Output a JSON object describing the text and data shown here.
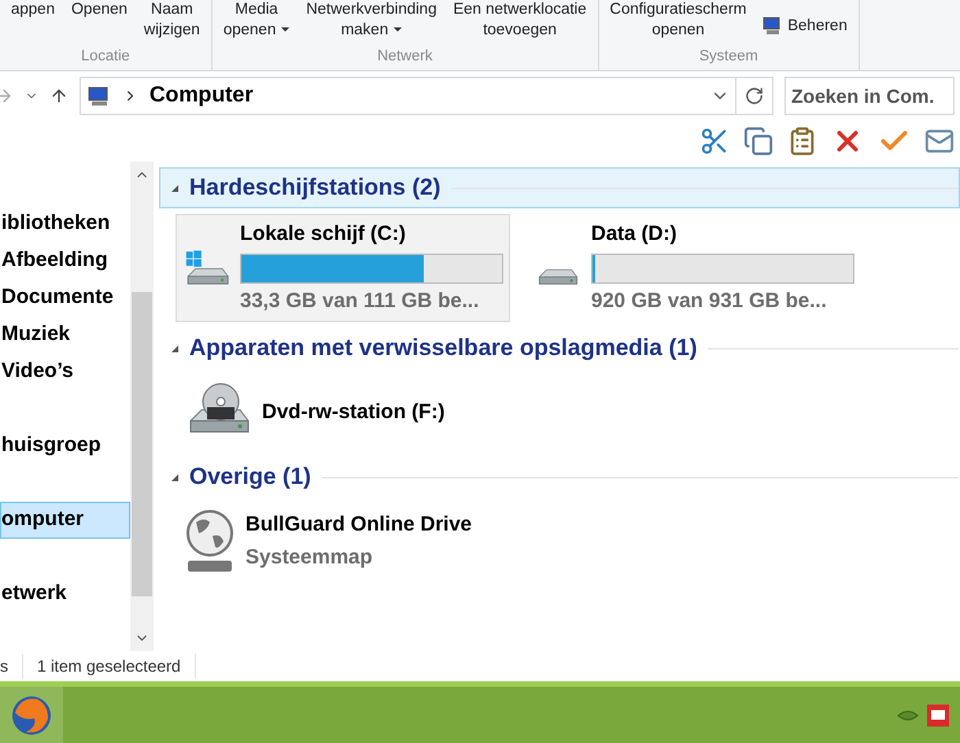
{
  "ribbon": {
    "groups": [
      {
        "label": "Locatie",
        "buttons": [
          {
            "lines": [
              "appen"
            ],
            "dropdown": false
          },
          {
            "lines": [
              "Openen"
            ],
            "dropdown": false
          },
          {
            "lines": [
              "Naam",
              "wijzigen"
            ],
            "dropdown": false
          }
        ]
      },
      {
        "label": "Netwerk",
        "buttons": [
          {
            "lines": [
              "Media",
              "openen"
            ],
            "dropdown": true
          },
          {
            "lines": [
              "Netwerkverbinding",
              "maken"
            ],
            "dropdown": true
          },
          {
            "lines": [
              "Een netwerklocatie",
              "toevoegen"
            ],
            "dropdown": false
          }
        ]
      },
      {
        "label": "Systeem",
        "buttons": [
          {
            "lines": [
              "Configuratiescherm",
              "openen"
            ],
            "dropdown": false
          },
          {
            "lines": [
              "Beheren"
            ],
            "dropdown": false,
            "icon": true
          }
        ]
      }
    ]
  },
  "address": {
    "path": "Computer",
    "search_placeholder": "Zoeken in Com."
  },
  "sidebar": {
    "items": [
      {
        "label": "ibliotheken",
        "selected": false
      },
      {
        "label": "Afbeelding",
        "selected": false
      },
      {
        "label": "Documente",
        "selected": false
      },
      {
        "label": "Muziek",
        "selected": false
      },
      {
        "label": "Video’s",
        "selected": false
      },
      {
        "label": "huisgroep",
        "selected": false
      },
      {
        "label": "omputer",
        "selected": true
      },
      {
        "label": "etwerk",
        "selected": false
      }
    ]
  },
  "sections": [
    {
      "title": "Hardeschijfstations (2)",
      "selected": true,
      "items": [
        {
          "kind": "system-drive",
          "name": "Lokale schijf (C:)",
          "detail": "33,3 GB van 111 GB be...",
          "level": 0.7,
          "selected": true
        },
        {
          "kind": "drive",
          "name": "Data (D:)",
          "detail": "920 GB van 931 GB be...",
          "level": 0.01,
          "selected": false
        }
      ]
    },
    {
      "title": "Apparaten met verwisselbare opslagmedia (1)",
      "selected": false,
      "items": [
        {
          "kind": "dvd",
          "name": "Dvd-rw-station (F:)",
          "selected": false
        }
      ]
    },
    {
      "title": "Overige (1)",
      "selected": false,
      "items": [
        {
          "kind": "globe",
          "name": "BullGuard Online Drive",
          "detail": "Systeemmap",
          "selected": false
        }
      ]
    }
  ],
  "status_bar": {
    "items": [
      "s",
      "1 item geselecteerd"
    ]
  }
}
